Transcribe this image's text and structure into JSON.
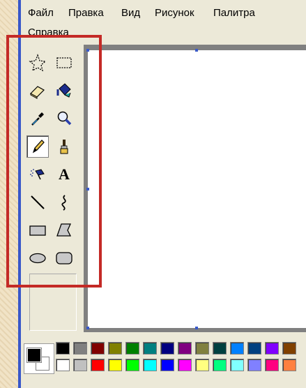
{
  "menu": [
    "Файл",
    "Правка",
    "Вид",
    "Рисунок",
    "Палитра",
    "Справка"
  ],
  "tools": [
    {
      "name": "free-form-select-tool",
      "icon": "star-select-icon"
    },
    {
      "name": "rect-select-tool",
      "icon": "dashed-rect-icon"
    },
    {
      "name": "eraser-tool",
      "icon": "eraser-icon"
    },
    {
      "name": "fill-tool",
      "icon": "paint-bucket-icon"
    },
    {
      "name": "pick-color-tool",
      "icon": "eyedropper-icon"
    },
    {
      "name": "magnifier-tool",
      "icon": "magnifier-icon"
    },
    {
      "name": "pencil-tool",
      "icon": "pencil-icon",
      "selected": true
    },
    {
      "name": "brush-tool",
      "icon": "brush-icon"
    },
    {
      "name": "airbrush-tool",
      "icon": "airbrush-icon"
    },
    {
      "name": "text-tool",
      "icon": "text-icon",
      "glyph": "A"
    },
    {
      "name": "line-tool",
      "icon": "line-icon"
    },
    {
      "name": "curve-tool",
      "icon": "curve-icon"
    },
    {
      "name": "rectangle-tool",
      "icon": "rectangle-icon"
    },
    {
      "name": "polygon-tool",
      "icon": "polygon-icon"
    },
    {
      "name": "ellipse-tool",
      "icon": "ellipse-icon"
    },
    {
      "name": "rounded-rect-tool",
      "icon": "rounded-rect-icon"
    }
  ],
  "colors": {
    "foreground": "#000000",
    "background": "#ffffff",
    "highlight": "#c42a26",
    "palette_top": [
      "#000000",
      "#808080",
      "#800000",
      "#808000",
      "#008000",
      "#008080",
      "#000080",
      "#800080",
      "#808040",
      "#004040",
      "#0080ff",
      "#004080",
      "#8000ff",
      "#804000"
    ],
    "palette_bottom": [
      "#ffffff",
      "#c0c0c0",
      "#ff0000",
      "#ffff00",
      "#00ff00",
      "#00ffff",
      "#0000ff",
      "#ff00ff",
      "#ffff80",
      "#00ff80",
      "#80ffff",
      "#8080ff",
      "#ff0080",
      "#ff8040"
    ]
  }
}
